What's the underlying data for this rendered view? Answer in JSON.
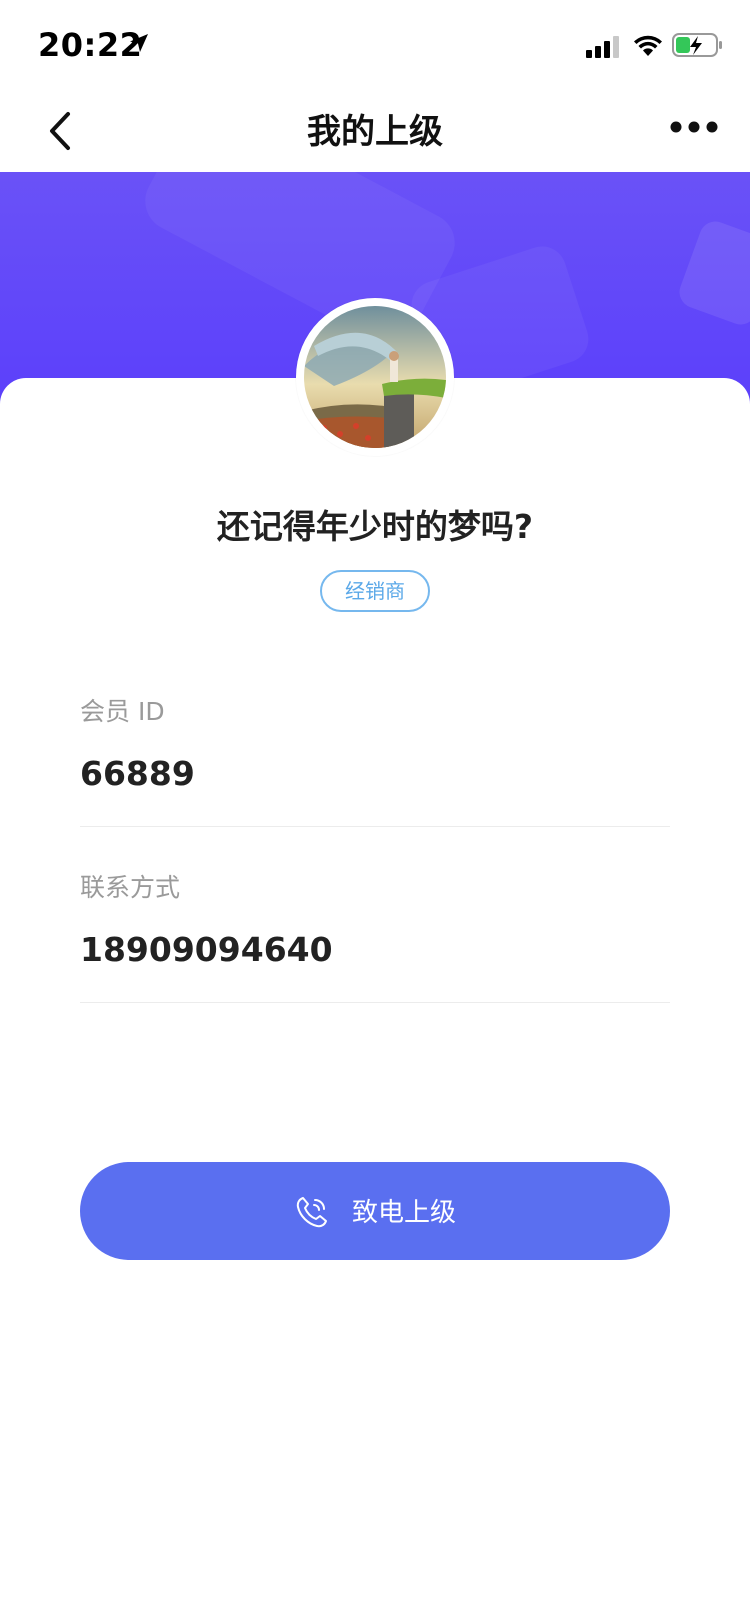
{
  "status_bar": {
    "time": "20:22"
  },
  "nav": {
    "title": "我的上级"
  },
  "profile": {
    "name": "还记得年少时的梦吗?",
    "role_badge": "经销商"
  },
  "fields": [
    {
      "label": "会员 ID",
      "value": "66889"
    },
    {
      "label": "联系方式",
      "value": "18909094640"
    }
  ],
  "actions": {
    "call_label": "致电上级"
  },
  "colors": {
    "banner": "#5b3ffb",
    "button": "#5a6ff0",
    "badge": "#5aa8e8"
  },
  "icons": {
    "back": "chevron-left-icon",
    "more": "more-dots-icon",
    "call": "phone-call-icon"
  }
}
